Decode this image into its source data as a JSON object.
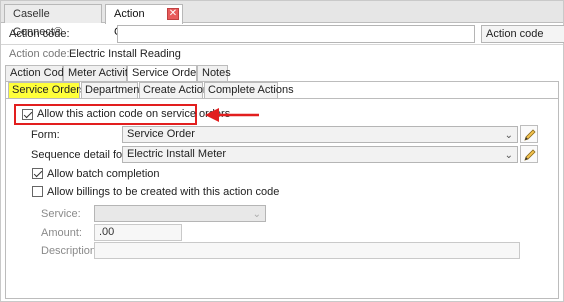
{
  "doc_tabs": [
    {
      "label": "Caselle Connect®"
    },
    {
      "label": "Action Codes"
    }
  ],
  "header": {
    "action_code_label": "Action code:",
    "action_code_value": "",
    "action_code_dropdown": "Action code",
    "action_code_desc_label": "Action code:",
    "action_code_desc_value": "Electric Install Reading"
  },
  "tabs": [
    "Action Code",
    "Meter Activity",
    "Service Orders",
    "Notes"
  ],
  "subtabs": [
    "Service Orders",
    "Departments",
    "Create Actions",
    "Complete Actions"
  ],
  "service_orders": {
    "allow_label": "Allow this action code on service orders",
    "allow_checked": true,
    "form_label": "Form:",
    "form_value": "Service Order",
    "seq_label": "Sequence detail form:",
    "seq_value": "Electric Install Meter",
    "batch_label": "Allow batch completion",
    "batch_checked": true,
    "billings_label": "Allow billings to be created with this action code",
    "billings_checked": false,
    "service_label": "Service:",
    "service_value": "",
    "amount_label": "Amount:",
    "amount_value": ".00",
    "description_label": "Description:",
    "description_value": ""
  },
  "annotation": {
    "arrow_color": "#e21e1e"
  }
}
